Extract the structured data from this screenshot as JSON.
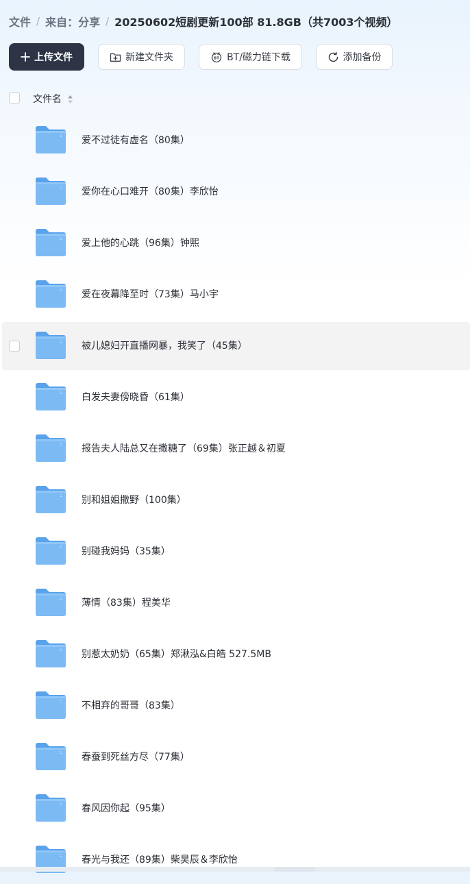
{
  "breadcrumb": {
    "items": [
      "文件",
      "来自：分享"
    ],
    "current": "20250602短剧更新100部 81.8GB（共7003个视频）"
  },
  "toolbar": {
    "upload_label": "上传文件",
    "new_folder_label": "新建文件夹",
    "bt_label": "BT/磁力链下载",
    "backup_label": "添加备份"
  },
  "list": {
    "header_label": "文件名",
    "items": [
      "爱不过徒有虚名（80集）",
      "爱你在心口难开（80集）李欣怡",
      "爱上他的心跳（96集）钟熙",
      "爱在夜幕降至时（73集）马小宇",
      "被儿媳妇开直播网暴，我笑了（45集）",
      "白发夫妻傍晓昏（61集）",
      "报告夫人陆总又在撒糖了（69集）张正越＆初夏",
      "别和姐姐撒野（100集）",
      "别碰我妈妈（35集）",
      "薄情（83集）程美华",
      "别惹太奶奶（65集）郑湫泓&白皓  527.5MB",
      "不相弃的哥哥（83集）",
      "春蚕到死丝方尽（77集）",
      "春风因你起（95集）",
      "春光与我还（89集）柴昊辰＆李欣怡"
    ]
  },
  "colors": {
    "primary_button": "#2e3446",
    "folder_blue": "#6aaef0",
    "hover_row": "#f3f3f4"
  },
  "icons": [
    "plus-icon",
    "new-folder-icon",
    "bt-icon",
    "backup-icon",
    "sort-icon",
    "folder-icon"
  ]
}
